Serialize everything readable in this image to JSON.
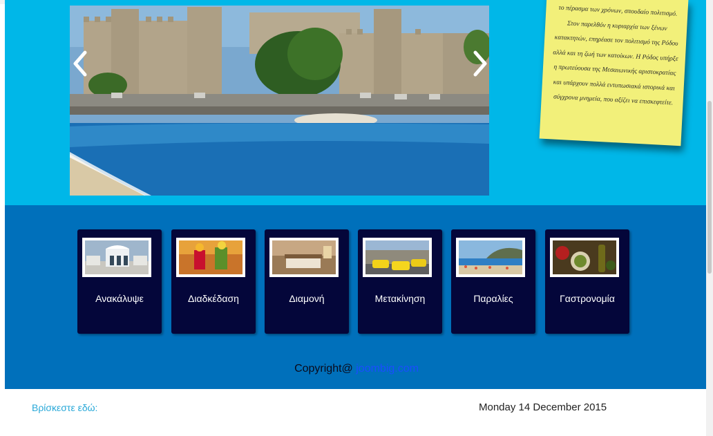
{
  "slider": {
    "prev_label": "‹",
    "next_label": "›",
    "image": "rhodes-castle-harbour-photo"
  },
  "note": {
    "text": "το πέρασμα των χρόνων, σπουδαίο πολιτισμό. Στον παρελθόν η κυριαρχία των ξένων κατακτητών, επηρέασε τον πολιτισμό της Ρόδου αλλά και τη ζωή των κατοίκων. Η Ρόδος υπήρξε η πρωτεύουσα της Μεσαιωνικής αριστοκρατίας και υπάρχουν πολλά εντυπωσιακά ιστορικά και σύγχρονα μνημεία, που αξίζει να επισκεφτείτε."
  },
  "categories": [
    {
      "label": "Ανακάλυψε",
      "thumb": "building-thumb"
    },
    {
      "label": "Διαδκέδαση",
      "thumb": "cocktails-thumb"
    },
    {
      "label": "Διαμονή",
      "thumb": "hotel-room-thumb"
    },
    {
      "label": "Μετακίνηση",
      "thumb": "taxis-thumb"
    },
    {
      "label": "Παραλίες",
      "thumb": "beach-thumb"
    },
    {
      "label": "Γαστρονομία",
      "thumb": "food-thumb"
    }
  ],
  "footer": {
    "copyright_prefix": "Copyright@ ",
    "copyright_link": "joombig.com"
  },
  "breadcrumb": {
    "label": "Βρίσκεστε εδώ:"
  },
  "date": {
    "text": "Monday 14 December 2015"
  },
  "colors": {
    "hero_bg": "#00b7e8",
    "band_bg": "#0070bb",
    "card_bg": "#04063a",
    "note_bg": "#f2f07a"
  }
}
